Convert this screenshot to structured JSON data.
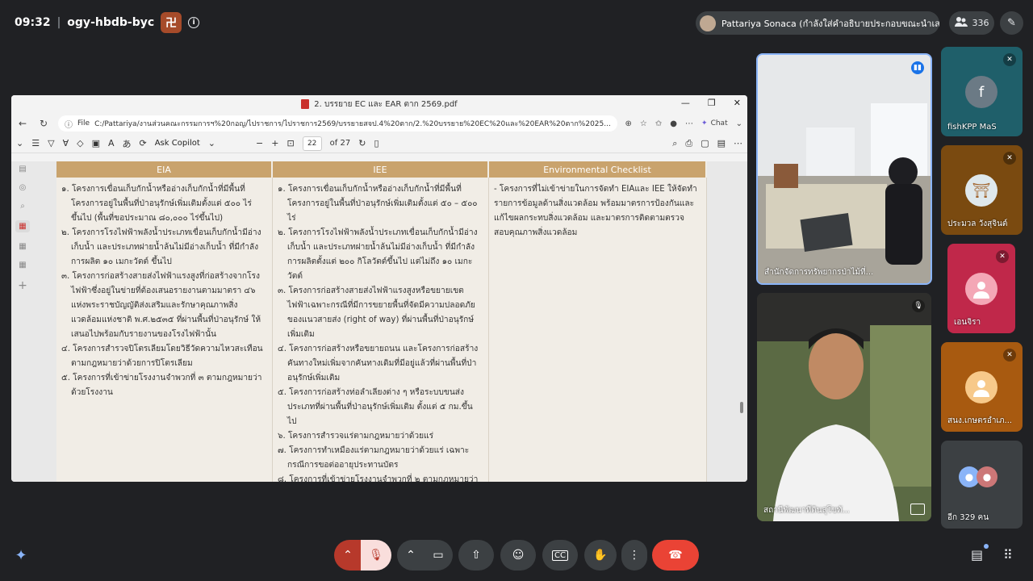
{
  "meeting": {
    "time": "09:32",
    "separator": "|",
    "code": "ogy-hbdb-byc",
    "presenter_label": "Pattariya Sonaca (กำลังใส่คำอธิบายประกอบขณะนำเสนอ)",
    "participant_count": "336"
  },
  "window": {
    "file_title": "2. บรรยาย EC และ EAR ตาก 2569.pdf",
    "file_label": "File",
    "url": "C:/Pattariya/งานส่วนคณะกรรมการฯ%20กอญ/ไปราชการ/ไปราชการ2569/บรรยายสจป.4%20ตาก/2.%20บรรยาย%20EC%20และ%20EAR%20ตาก%2025...",
    "chat_label": "Chat",
    "ask_copilot": "Ask Copilot",
    "page_current": "22",
    "page_total": "of 27"
  },
  "table": {
    "headers": [
      "EIA",
      "IEE",
      "Environmental Checklist"
    ],
    "eia_items": [
      "๑. โครงการเขื่อนเก็บกักน้ำหรืออ่างเก็บกักน้ำที่มีพื้นที่โครงการอยู่ในพื้นที่ป่าอนุรักษ์เพิ่มเติมตั้งแต่ ๕๐๐ ไร่ ขึ้นไป (พื้นที่ขอประมาณ ๘๐,๐๐๐ ไร่ขึ้นไป)",
      "๒. โครงการโรงไฟฟ้าพลังน้ำประเภทเขื่อนเก็บกักน้ำมีอ่างเก็บน้ำ และประเภทฝายน้ำล้นไม่มีอ่างเก็บน้ำ ที่มีกำลังการผลิต ๑๐ เมกะวัตต์ ขึ้นไป",
      "๓. โครงการก่อสร้างสายส่งไฟฟ้าแรงสูงที่ก่อสร้างจากโรงไฟฟ้าซึ่งอยู่ในข่ายที่ต้องเสนอรายงานตามมาตรา ๔๖ แห่งพระราชบัญญัติส่งเสริมและรักษาคุณภาพสิ่งแวดล้อมแห่งชาติ พ.ศ.๒๕๓๕ ที่ผ่านพื้นที่ป่าอนุรักษ์ ให้เสนอไปพร้อมกับรายงานของโรงไฟฟ้านั้น",
      "๔. โครงการสำรวจปิโตรเลียมโดยวิธีวัดความไหวสะเทือนตามกฎหมายว่าด้วยการปิโตรเลียม",
      "๕. โครงการที่เข้าข่ายโรงงานจำพวกที่ ๓ ตามกฎหมายว่าด้วยโรงงาน"
    ],
    "iee_items": [
      "๑. โครงการเขื่อนเก็บกักน้ำหรืออ่างเก็บกักน้ำที่มีพื้นที่โครงการอยู่ในพื้นที่ป่าอนุรักษ์เพิ่มเติมตั้งแต่ ๕๐ – ๕๐๐ ไร่",
      "๒. โครงการโรงไฟฟ้าพลังน้ำประเภทเขื่อนเก็บกักน้ำมีอ่างเก็บน้ำ และประเภทฝายน้ำล้นไม่มีอ่างเก็บน้ำ ที่มีกำลังการผลิตตั้งแต่ ๒๐๐ กิโลวัตต์ขึ้นไป แต่ไม่ถึง ๑๐ เมกะวัตต์",
      "๓. โครงการก่อสร้างสายส่งไฟฟ้าแรงสูงหรือขยายเขตไฟฟ้าเฉพาะกรณีที่มีการขยายพื้นที่จัดมีความปลอดภัยของแนวสายส่ง (right of way) ที่ผ่านพื้นที่ป่าอนุรักษ์เพิ่มเติม",
      "๔. โครงการก่อสร้างหรือขยายถนน และโครงการก่อสร้างคันทางใหม่เพิ่มจากคันทางเดิมที่มีอยู่แล้วที่ผ่านพื้นที่ป่าอนุรักษ์เพิ่มเติม",
      "๕. โครงการก่อสร้างท่อลำเลียงต่าง ๆ หรือระบบขนส่งประเภทที่ผ่านพื้นที่ป่าอนุรักษ์เพิ่มเติม ตั้งแต่ ๕ กม.ขึ้นไป",
      "๖. โครงการสำรวจแร่ตามกฎหมายว่าด้วยแร่",
      "๗. โครงการทำเหมืองแร่ตามกฎหมายว่าด้วยแร่ เฉพาะกรณีการขอต่ออายุประทานบัตร",
      "๘. โครงการที่เข้าข่ายโรงงานจำพวกที่ ๒ ตามกฎหมายว่าด้วยโรงงาน"
    ],
    "checklist_text": "- โครงการที่ไม่เข้าข่ายในการจัดทำ EIAและ IEE ให้จัดทำรายการข้อมูลด้านสิ่งแวดล้อม พร้อมมาตรการป้องกันและแก้ไขผลกระทบสิ่งแวดล้อม และมาตรการติดตามตรวจสอบคุณภาพสิ่งแวดล้อม"
  },
  "tiles": {
    "cam_room_name": "สำนักจัดการทรัพยากรป่าไม้ที่...",
    "cam_man_name": "สถานีพัฒนาที่ดินสุโขทั...",
    "p1_name": "fishKPP MaS",
    "p1_initial": "f",
    "p2_name": "ประมวล วังสุจินต์",
    "p3_name": "เอนจิรา",
    "p4_name": "สนง.เกษตรอำเภ...",
    "others_label": "อีก 329 คน"
  },
  "colors": {
    "accent": "#8ab4f8",
    "end_call": "#ea4335",
    "mic_off": "#b7392b",
    "table_header": "#c9a36d"
  }
}
